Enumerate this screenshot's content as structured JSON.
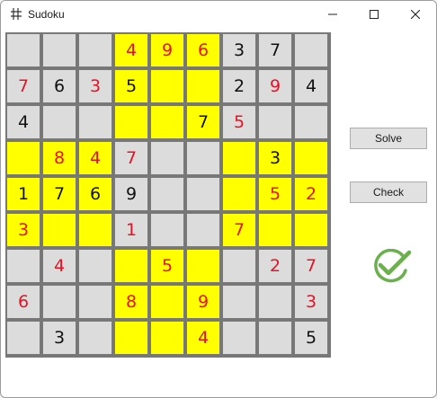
{
  "window": {
    "title": "Sudoku"
  },
  "buttons": {
    "solve": "Solve",
    "check": "Check"
  },
  "status": {
    "icon": "checkmark-circle-icon",
    "color": "#6ab04c"
  },
  "colors": {
    "given_digit": "#111111",
    "user_digit": "#e81123",
    "highlight": "#ffff00",
    "cell": "#dcdcdc"
  },
  "board": [
    [
      {
        "v": "",
        "c": "g",
        "t": "given"
      },
      {
        "v": "",
        "c": "g",
        "t": "given"
      },
      {
        "v": "",
        "c": "g",
        "t": "given"
      },
      {
        "v": "4",
        "c": "y",
        "t": "user"
      },
      {
        "v": "9",
        "c": "y",
        "t": "user"
      },
      {
        "v": "6",
        "c": "y",
        "t": "user"
      },
      {
        "v": "3",
        "c": "g",
        "t": "given"
      },
      {
        "v": "7",
        "c": "g",
        "t": "given"
      },
      {
        "v": "",
        "c": "g",
        "t": "given"
      }
    ],
    [
      {
        "v": "7",
        "c": "g",
        "t": "user"
      },
      {
        "v": "6",
        "c": "g",
        "t": "given"
      },
      {
        "v": "3",
        "c": "g",
        "t": "user"
      },
      {
        "v": "5",
        "c": "y",
        "t": "given"
      },
      {
        "v": "",
        "c": "y",
        "t": "given"
      },
      {
        "v": "",
        "c": "y",
        "t": "given"
      },
      {
        "v": "2",
        "c": "g",
        "t": "given"
      },
      {
        "v": "9",
        "c": "g",
        "t": "user"
      },
      {
        "v": "4",
        "c": "g",
        "t": "given"
      }
    ],
    [
      {
        "v": "4",
        "c": "g",
        "t": "given"
      },
      {
        "v": "",
        "c": "g",
        "t": "given"
      },
      {
        "v": "",
        "c": "g",
        "t": "given"
      },
      {
        "v": "",
        "c": "y",
        "t": "given"
      },
      {
        "v": "",
        "c": "y",
        "t": "given"
      },
      {
        "v": "7",
        "c": "y",
        "t": "given"
      },
      {
        "v": "5",
        "c": "g",
        "t": "user"
      },
      {
        "v": "",
        "c": "g",
        "t": "given"
      },
      {
        "v": "",
        "c": "g",
        "t": "given"
      }
    ],
    [
      {
        "v": "",
        "c": "y",
        "t": "given"
      },
      {
        "v": "8",
        "c": "y",
        "t": "user"
      },
      {
        "v": "4",
        "c": "y",
        "t": "user"
      },
      {
        "v": "7",
        "c": "g",
        "t": "user"
      },
      {
        "v": "",
        "c": "g",
        "t": "given"
      },
      {
        "v": "",
        "c": "g",
        "t": "given"
      },
      {
        "v": "",
        "c": "y",
        "t": "given"
      },
      {
        "v": "3",
        "c": "y",
        "t": "given"
      },
      {
        "v": "",
        "c": "y",
        "t": "given"
      }
    ],
    [
      {
        "v": "1",
        "c": "y",
        "t": "given"
      },
      {
        "v": "7",
        "c": "y",
        "t": "given"
      },
      {
        "v": "6",
        "c": "y",
        "t": "given"
      },
      {
        "v": "9",
        "c": "g",
        "t": "given"
      },
      {
        "v": "",
        "c": "g",
        "t": "given"
      },
      {
        "v": "",
        "c": "g",
        "t": "given"
      },
      {
        "v": "",
        "c": "y",
        "t": "given"
      },
      {
        "v": "5",
        "c": "y",
        "t": "user"
      },
      {
        "v": "2",
        "c": "y",
        "t": "user"
      }
    ],
    [
      {
        "v": "3",
        "c": "y",
        "t": "user"
      },
      {
        "v": "",
        "c": "y",
        "t": "given"
      },
      {
        "v": "",
        "c": "y",
        "t": "given"
      },
      {
        "v": "1",
        "c": "g",
        "t": "user"
      },
      {
        "v": "",
        "c": "g",
        "t": "given"
      },
      {
        "v": "",
        "c": "g",
        "t": "given"
      },
      {
        "v": "7",
        "c": "y",
        "t": "user"
      },
      {
        "v": "",
        "c": "y",
        "t": "given"
      },
      {
        "v": "",
        "c": "y",
        "t": "given"
      }
    ],
    [
      {
        "v": "",
        "c": "g",
        "t": "given"
      },
      {
        "v": "4",
        "c": "g",
        "t": "user"
      },
      {
        "v": "",
        "c": "g",
        "t": "given"
      },
      {
        "v": "",
        "c": "y",
        "t": "given"
      },
      {
        "v": "5",
        "c": "y",
        "t": "user"
      },
      {
        "v": "",
        "c": "y",
        "t": "given"
      },
      {
        "v": "",
        "c": "g",
        "t": "given"
      },
      {
        "v": "2",
        "c": "g",
        "t": "user"
      },
      {
        "v": "7",
        "c": "g",
        "t": "user"
      }
    ],
    [
      {
        "v": "6",
        "c": "g",
        "t": "user"
      },
      {
        "v": "",
        "c": "g",
        "t": "given"
      },
      {
        "v": "",
        "c": "g",
        "t": "given"
      },
      {
        "v": "8",
        "c": "y",
        "t": "user"
      },
      {
        "v": "",
        "c": "y",
        "t": "given"
      },
      {
        "v": "9",
        "c": "y",
        "t": "user"
      },
      {
        "v": "",
        "c": "g",
        "t": "given"
      },
      {
        "v": "",
        "c": "g",
        "t": "given"
      },
      {
        "v": "3",
        "c": "g",
        "t": "user"
      }
    ],
    [
      {
        "v": "",
        "c": "g",
        "t": "given"
      },
      {
        "v": "3",
        "c": "g",
        "t": "given"
      },
      {
        "v": "",
        "c": "g",
        "t": "given"
      },
      {
        "v": "",
        "c": "y",
        "t": "given"
      },
      {
        "v": "",
        "c": "y",
        "t": "given"
      },
      {
        "v": "4",
        "c": "y",
        "t": "user"
      },
      {
        "v": "",
        "c": "g",
        "t": "given"
      },
      {
        "v": "",
        "c": "g",
        "t": "given"
      },
      {
        "v": "5",
        "c": "g",
        "t": "given"
      }
    ]
  ]
}
